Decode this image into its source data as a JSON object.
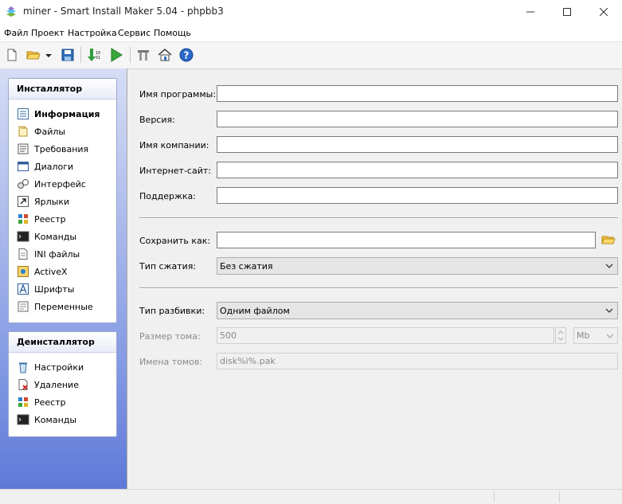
{
  "window": {
    "title": "miner - Smart Install Maker 5.04 - phpbb3"
  },
  "menu": [
    "Файл",
    "Проект",
    "Настройка",
    "Сервис",
    "Помощь"
  ],
  "toolbar": [
    "new-file-icon",
    "open-folder-icon",
    "dropdown-arrow-icon",
    "save-icon",
    "build-icon",
    "run-icon",
    "settings-icon",
    "home-icon",
    "help-icon"
  ],
  "sidebar": {
    "installer": {
      "title": "Инсталлятор",
      "items": [
        "Информация",
        "Файлы",
        "Требования",
        "Диалоги",
        "Интерфейс",
        "Ярлыки",
        "Реестр",
        "Команды",
        "INI файлы",
        "ActiveX",
        "Шрифты",
        "Переменные"
      ],
      "active": "Информация"
    },
    "uninstaller": {
      "title": "Деинсталлятор",
      "items": [
        "Настройки",
        "Удаление",
        "Реестр",
        "Команды"
      ]
    }
  },
  "form": {
    "program_name_label": "Имя программы:",
    "program_name_value": "",
    "version_label": "Версия:",
    "version_value": "",
    "company_label": "Имя компании:",
    "company_value": "",
    "website_label": "Интернет-сайт:",
    "website_value": "",
    "support_label": "Поддержка:",
    "support_value": "",
    "save_as_label": "Сохранить как:",
    "save_as_value": "",
    "compression_label": "Тип сжатия:",
    "compression_value": "Без сжатия",
    "split_label": "Тип разбивки:",
    "split_value": "Одним файлом",
    "volume_size_label": "Размер тома:",
    "volume_size_value": "500",
    "volume_unit": "Mb",
    "volume_names_label": "Имена томов:",
    "volume_names_value": "disk%i%.pak"
  },
  "colors": {
    "sidebar_top": "#d5ddf5",
    "sidebar_bottom": "#5f79d8",
    "panel_border": "#9aa7cf"
  }
}
